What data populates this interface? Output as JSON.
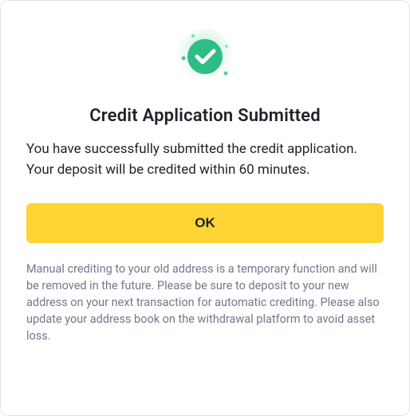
{
  "dialog": {
    "icon": "success-check-icon",
    "title": "Credit Application Submitted",
    "message": "You have successfully submitted the credit application. Your deposit will be credited within 60 minutes.",
    "ok_label": "OK",
    "footnote": "Manual crediting to your old address is a temporary function and will be removed in the future. Please be sure to deposit to your new address on your next transaction for automatic crediting. Please also update your address book on the withdrawal platform to avoid asset loss."
  },
  "colors": {
    "accent": "#fcd535",
    "success": "#2ebd85",
    "text": "#1e2329",
    "muted": "#707a8a"
  }
}
